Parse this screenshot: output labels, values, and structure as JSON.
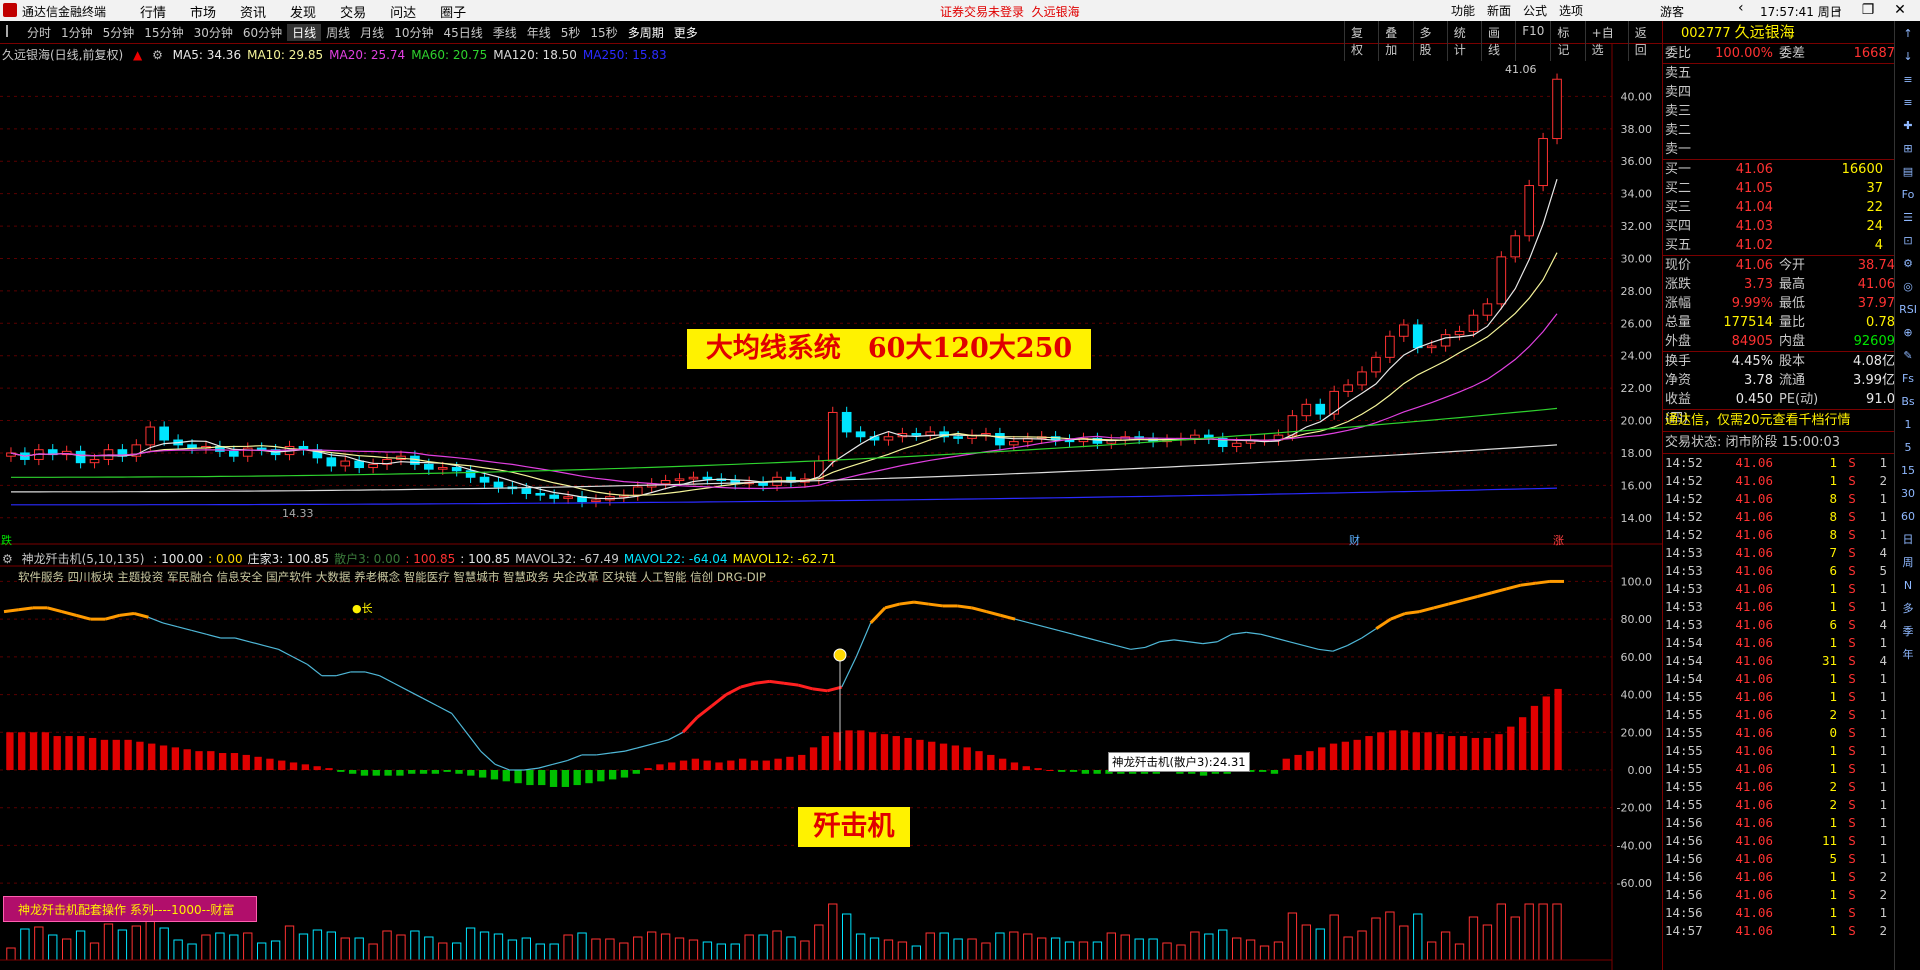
{
  "app": {
    "name": "通达信金融终端",
    "notice": "证券交易未登录",
    "stock_name": "久远银海",
    "guest": "游客",
    "time": "17:57:41 周日"
  },
  "menu": [
    "行情",
    "市场",
    "资讯",
    "发现",
    "交易",
    "问达",
    "圈子"
  ],
  "right_menu": [
    "功能",
    "新面",
    "公式",
    "选项"
  ],
  "periods": [
    "分时",
    "1分钟",
    "5分钟",
    "15分钟",
    "30分钟",
    "60分钟",
    "日线",
    "周线",
    "月线",
    "10分钟",
    "45日线",
    "季线",
    "年线",
    "5秒",
    "15秒",
    "多周期",
    "更多"
  ],
  "tools": [
    "复权",
    "叠加",
    "多股",
    "统计",
    "画线",
    "F10",
    "标记",
    "+自选",
    "返回"
  ],
  "main_chart": {
    "label": "久远银海(日线,前复权)",
    "ma": [
      {
        "name": "MA5",
        "value": "34.36",
        "color": "#e8e8e8"
      },
      {
        "name": "MA10",
        "value": "29.85",
        "color": "#f5f59a"
      },
      {
        "name": "MA20",
        "value": "25.74",
        "color": "#e040e0"
      },
      {
        "name": "MA60",
        "value": "20.75",
        "color": "#2ed22e"
      },
      {
        "name": "MA120",
        "value": "18.50",
        "color": "#dcdcdc"
      },
      {
        "name": "MA250",
        "value": "15.83",
        "color": "#2a2aff"
      }
    ],
    "yticks": [
      "40.00",
      "38.00",
      "36.00",
      "34.00",
      "32.00",
      "30.00",
      "28.00",
      "26.00",
      "24.00",
      "22.00",
      "20.00",
      "18.00",
      "16.00",
      "14.00"
    ],
    "high_label": "41.06",
    "low_label": "14.33",
    "banner": "大均线系统　60大120大250",
    "bottom_left": "跌",
    "bottom_mid": "财",
    "bottom_right": "涨"
  },
  "indicator": {
    "label": "神龙歼击机(5,10,135)",
    "values": [
      {
        "t": ": 100.00",
        "c": "#e8e8e8"
      },
      {
        "t": ": 0.00",
        "c": "#ffd700"
      },
      {
        "t": "庄家3: 100.85",
        "c": "#e8e8e8"
      },
      {
        "t": "散户3: 0.00",
        "c": "#3a7a3a"
      },
      {
        "t": ": 100.85",
        "c": "#ff3232"
      },
      {
        "t": ": 100.85",
        "c": "#e8e8e8"
      },
      {
        "t": "MAVOL32: -67.49",
        "c": "#c8c8c8"
      },
      {
        "t": "MAVOL22: -64.04",
        "c": "#00e5ff"
      },
      {
        "t": "MAVOL12: -62.71",
        "c": "#fff200"
      }
    ],
    "sectors": "软件服务 四川板块 主题投资 军民融合 信息安全 国产软件 大数据 养老概念 智能医疗 智慧城市 智慧政务 央企改革 区块链 人工智能 信创 DRG-DIP",
    "yticks": [
      "100.0",
      "80.00",
      "60.00",
      "40.00",
      "20.00",
      "0.00",
      "-20.00",
      "-40.00",
      "-60.00"
    ],
    "marker": "长",
    "tip": "神龙歼击机(散户3):24.31",
    "banner": "歼击机",
    "series_btn": "神龙歼击机配套操作 系列----1000--财富"
  },
  "quote": {
    "code": "002777",
    "name": "久远银海",
    "weibi": {
      "l": "委比",
      "v": "100.00%",
      "l2": "委差",
      "v2": "16687"
    },
    "sell": [
      {
        "l": "卖五"
      },
      {
        "l": "卖四"
      },
      {
        "l": "卖三"
      },
      {
        "l": "卖二"
      },
      {
        "l": "卖一"
      }
    ],
    "buy": [
      {
        "l": "买一",
        "p": "41.06",
        "v": "16600"
      },
      {
        "l": "买二",
        "p": "41.05",
        "v": "37"
      },
      {
        "l": "买三",
        "p": "41.04",
        "v": "22"
      },
      {
        "l": "买四",
        "p": "41.03",
        "v": "24"
      },
      {
        "l": "买五",
        "p": "41.02",
        "v": "4"
      }
    ],
    "stats": [
      {
        "a": "现价",
        "b": "41.06",
        "bc": "red",
        "c": "今开",
        "d": "38.74",
        "dc": "red"
      },
      {
        "a": "涨跌",
        "b": "3.73",
        "bc": "red",
        "c": "最高",
        "d": "41.06",
        "dc": "red"
      },
      {
        "a": "涨幅",
        "b": "9.99%",
        "bc": "red",
        "c": "最低",
        "d": "37.97",
        "dc": "red"
      },
      {
        "a": "总量",
        "b": "177514",
        "bc": "yel",
        "c": "量比",
        "d": "0.78",
        "dc": "yel"
      },
      {
        "a": "外盘",
        "b": "84905",
        "bc": "red",
        "c": "内盘",
        "d": "92609",
        "dc": "green"
      }
    ],
    "stats2": [
      {
        "a": "换手",
        "b": "4.45%",
        "bc": "wh",
        "c": "股本",
        "d": "4.08亿",
        "dc": "wh"
      },
      {
        "a": "净资",
        "b": "3.78",
        "bc": "wh",
        "c": "流通",
        "d": "3.99亿",
        "dc": "wh"
      },
      {
        "a": "收益(四)",
        "b": "0.450",
        "bc": "wh",
        "c": "PE(动)",
        "d": "91.0",
        "dc": "wh"
      }
    ],
    "ad": "通达信，仅需20元查看千档行情",
    "status": "交易状态: 闭市阶段 15:00:03",
    "ticks": [
      {
        "t": "14:52",
        "p": "41.06",
        "v": "1",
        "s": "S",
        "n": "1"
      },
      {
        "t": "14:52",
        "p": "41.06",
        "v": "1",
        "s": "S",
        "n": "2"
      },
      {
        "t": "14:52",
        "p": "41.06",
        "v": "8",
        "s": "S",
        "n": "1"
      },
      {
        "t": "14:52",
        "p": "41.06",
        "v": "8",
        "s": "S",
        "n": "1"
      },
      {
        "t": "14:52",
        "p": "41.06",
        "v": "8",
        "s": "S",
        "n": "1"
      },
      {
        "t": "14:53",
        "p": "41.06",
        "v": "7",
        "s": "S",
        "n": "4"
      },
      {
        "t": "14:53",
        "p": "41.06",
        "v": "6",
        "s": "S",
        "n": "5"
      },
      {
        "t": "14:53",
        "p": "41.06",
        "v": "1",
        "s": "S",
        "n": "1"
      },
      {
        "t": "14:53",
        "p": "41.06",
        "v": "1",
        "s": "S",
        "n": "1"
      },
      {
        "t": "14:53",
        "p": "41.06",
        "v": "6",
        "s": "S",
        "n": "4"
      },
      {
        "t": "14:54",
        "p": "41.06",
        "v": "1",
        "s": "S",
        "n": "1"
      },
      {
        "t": "14:54",
        "p": "41.06",
        "v": "31",
        "s": "S",
        "n": "4"
      },
      {
        "t": "14:54",
        "p": "41.06",
        "v": "1",
        "s": "S",
        "n": "1"
      },
      {
        "t": "14:55",
        "p": "41.06",
        "v": "1",
        "s": "S",
        "n": "1"
      },
      {
        "t": "14:55",
        "p": "41.06",
        "v": "2",
        "s": "S",
        "n": "1"
      },
      {
        "t": "14:55",
        "p": "41.06",
        "v": "0",
        "s": "S",
        "n": "1"
      },
      {
        "t": "14:55",
        "p": "41.06",
        "v": "1",
        "s": "S",
        "n": "1"
      },
      {
        "t": "14:55",
        "p": "41.06",
        "v": "1",
        "s": "S",
        "n": "1"
      },
      {
        "t": "14:55",
        "p": "41.06",
        "v": "2",
        "s": "S",
        "n": "1"
      },
      {
        "t": "14:55",
        "p": "41.06",
        "v": "2",
        "s": "S",
        "n": "1"
      },
      {
        "t": "14:56",
        "p": "41.06",
        "v": "1",
        "s": "S",
        "n": "1"
      },
      {
        "t": "14:56",
        "p": "41.06",
        "v": "11",
        "s": "S",
        "n": "1"
      },
      {
        "t": "14:56",
        "p": "41.06",
        "v": "5",
        "s": "S",
        "n": "1"
      },
      {
        "t": "14:56",
        "p": "41.06",
        "v": "1",
        "s": "S",
        "n": "2"
      },
      {
        "t": "14:56",
        "p": "41.06",
        "v": "1",
        "s": "S",
        "n": "2"
      },
      {
        "t": "14:56",
        "p": "41.06",
        "v": "1",
        "s": "S",
        "n": "1"
      },
      {
        "t": "14:57",
        "p": "41.06",
        "v": "1",
        "s": "S",
        "n": "2"
      }
    ]
  },
  "sidebar": [
    "↑",
    "↓",
    "≡",
    "≡",
    "✚",
    "⊞",
    "▤",
    "Fo",
    "☰",
    "⊡",
    "⚙",
    "◎",
    "RSI",
    "⊕",
    "✎",
    "Fs",
    "Bs",
    "1",
    "5",
    "15",
    "30",
    "60",
    "日",
    "周",
    "N",
    "多",
    "季",
    "年"
  ],
  "chart_data": [
    {
      "type": "candlestick",
      "title": "久远银海(日线,前复权)",
      "ylim": [
        13,
        42
      ],
      "high": 41.06,
      "low": 14.33,
      "close": [
        18.0,
        17.6,
        18.2,
        17.9,
        18.1,
        17.4,
        17.6,
        18.2,
        17.8,
        18.5,
        19.6,
        18.8,
        18.5,
        18.3,
        18.4,
        18.1,
        17.8,
        18.3,
        18.2,
        17.9,
        18.4,
        18.2,
        17.7,
        17.2,
        17.5,
        17.1,
        17.3,
        17.6,
        17.8,
        17.3,
        17.0,
        17.1,
        16.9,
        16.5,
        16.2,
        15.9,
        15.8,
        15.5,
        15.4,
        15.2,
        15.3,
        15.0,
        15.1,
        15.3,
        15.4,
        15.9,
        16.1,
        16.3,
        16.4,
        16.5,
        16.4,
        16.3,
        16.1,
        16.2,
        16.0,
        16.5,
        16.2,
        16.4,
        17.5,
        20.5,
        19.3,
        19.0,
        18.8,
        19.0,
        19.2,
        19.1,
        19.3,
        19.0,
        18.9,
        19.1,
        19.2,
        18.5,
        18.7,
        18.9,
        19.0,
        18.8,
        18.7,
        18.9,
        18.6,
        18.8,
        19.0,
        18.9,
        18.7,
        18.8,
        18.9,
        19.1,
        18.9,
        18.4,
        18.6,
        18.8,
        18.8,
        19.1,
        20.3,
        21.0,
        20.4,
        21.8,
        22.2,
        23.0,
        23.9,
        25.2,
        25.9,
        24.5,
        24.6,
        25.3,
        25.5,
        26.5,
        27.2,
        30.1,
        31.4,
        34.5,
        37.4,
        41.06
      ],
      "ma": {
        "MA5": 34.36,
        "MA10": 29.85,
        "MA20": 25.74,
        "MA60": 20.75,
        "MA120": 18.5,
        "MA250": 15.83
      }
    },
    {
      "type": "bar",
      "title": "神龙歼击机(5,10,135)",
      "ylim": [
        -70,
        105
      ],
      "values": [
        20,
        20,
        20,
        20,
        18,
        18,
        18,
        17,
        16,
        16,
        16,
        15,
        14,
        13,
        12,
        11,
        10,
        10,
        9,
        9,
        8,
        7,
        6,
        5,
        4,
        3,
        2,
        1,
        -1,
        -2,
        -3,
        -3,
        -3,
        -3,
        -2,
        -2,
        -2,
        -1,
        -2,
        -3,
        -4,
        -5,
        -6,
        -7,
        -8,
        -8,
        -9,
        -9,
        -8,
        -7,
        -6,
        -5,
        -4,
        -2,
        1,
        3,
        4,
        5,
        6,
        5,
        4,
        5,
        6,
        5,
        5,
        6,
        7,
        8,
        12,
        18,
        20,
        21,
        21,
        20,
        19,
        18,
        17,
        16,
        15,
        14,
        13,
        12,
        10,
        8,
        6,
        4,
        2,
        1,
        0,
        -1,
        -1,
        -2,
        -2,
        -2,
        -2,
        -2,
        -2,
        -2,
        -1,
        -2,
        -2,
        -3,
        -2,
        -2,
        -1,
        -1,
        -1,
        -2,
        6,
        8,
        10,
        12,
        14,
        15,
        16,
        18,
        20,
        21,
        21,
        20,
        20,
        19,
        18,
        18,
        17,
        17,
        19,
        23,
        28,
        34,
        39,
        43
      ],
      "line": [
        84,
        85,
        86,
        86,
        84,
        82,
        80,
        80,
        82,
        83,
        81,
        78,
        76,
        74,
        72,
        70,
        70,
        68,
        66,
        64,
        60,
        56,
        50,
        50,
        52,
        52,
        50,
        46,
        42,
        38,
        34,
        30,
        20,
        10,
        3,
        0,
        0,
        1,
        3,
        5,
        8,
        8,
        9,
        10,
        12,
        14,
        16,
        20,
        28,
        34,
        40,
        44,
        46,
        47,
        46,
        45,
        43,
        42,
        44,
        60,
        78,
        86,
        88,
        89,
        88,
        87,
        87,
        86,
        84,
        82,
        80,
        78,
        76,
        74,
        72,
        70,
        68,
        66,
        64,
        65,
        68,
        69,
        68,
        67,
        68,
        72,
        73,
        72,
        70,
        68,
        66,
        64,
        63,
        66,
        70,
        75,
        80,
        83,
        84,
        86,
        88,
        90,
        92,
        94,
        96,
        98,
        99,
        100,
        100
      ]
    }
  ]
}
